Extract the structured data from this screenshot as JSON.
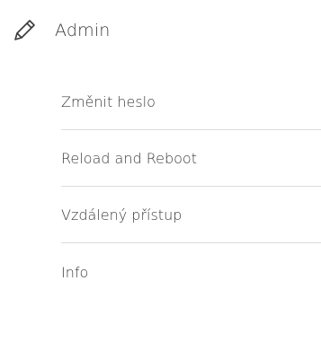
{
  "menu": {
    "header": {
      "icon": "pencil-icon",
      "title": "Admin"
    },
    "items": [
      {
        "label": "Změnit heslo"
      },
      {
        "label": "Reload and Reboot"
      },
      {
        "label": "Vzdálený přístup"
      },
      {
        "label": "Info"
      }
    ]
  }
}
